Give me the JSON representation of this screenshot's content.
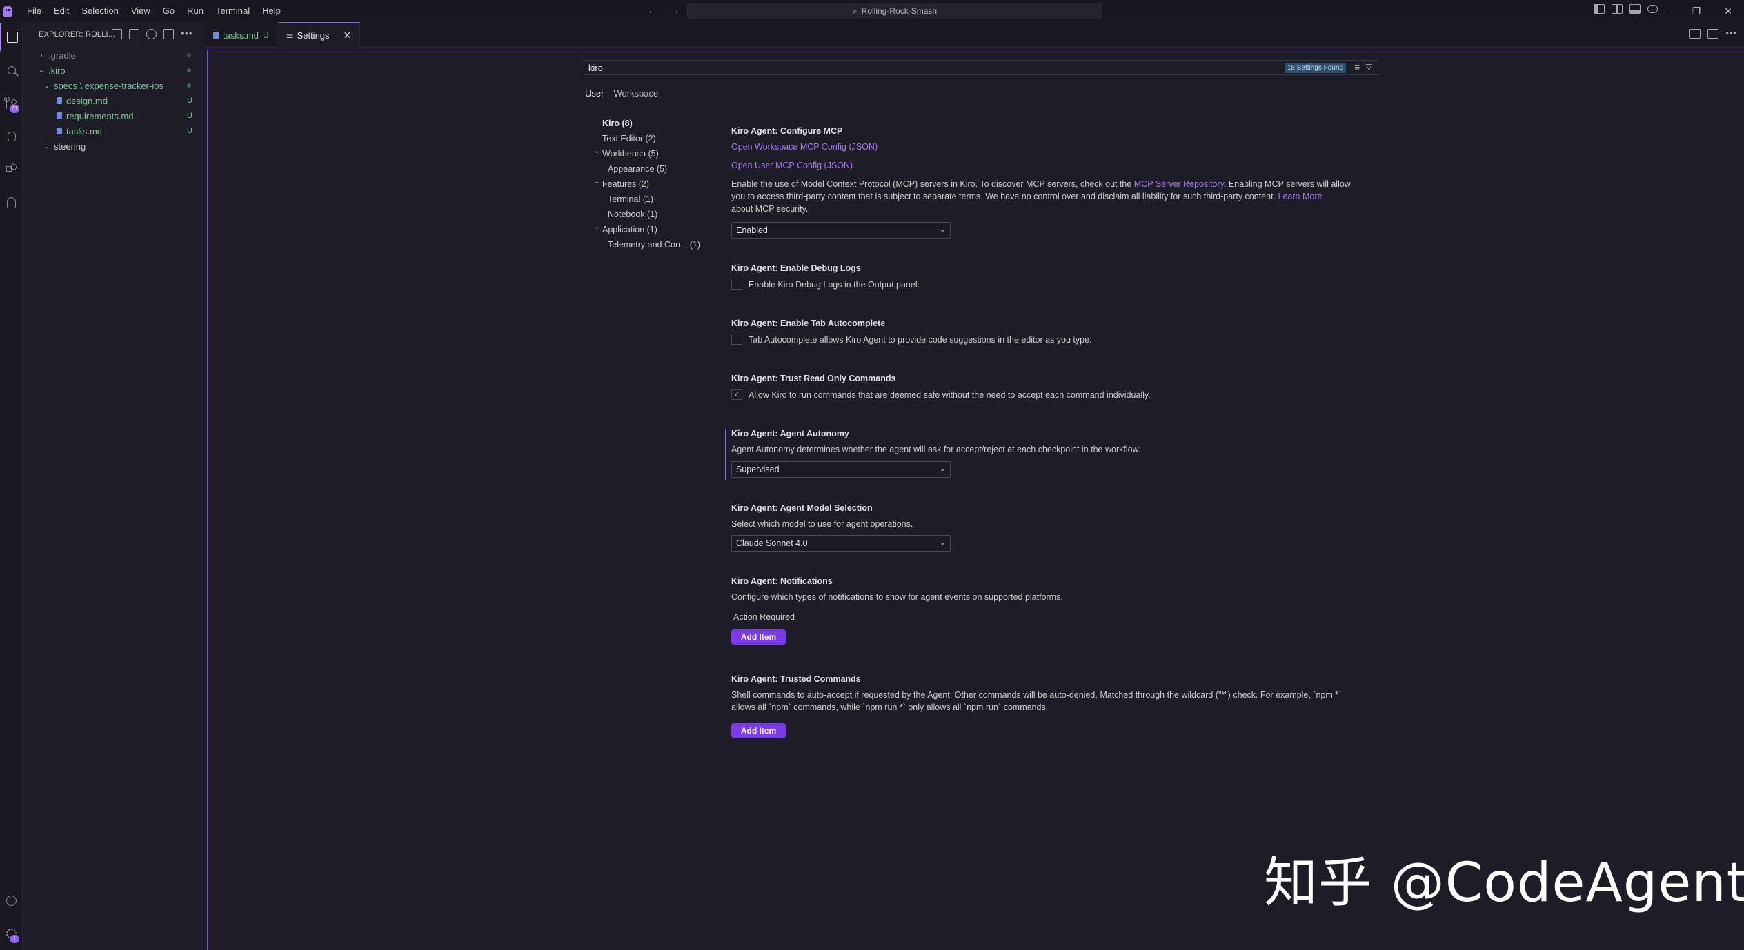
{
  "menubar": [
    "File",
    "Edit",
    "Selection",
    "View",
    "Go",
    "Run",
    "Terminal",
    "Help"
  ],
  "command_center": {
    "label": "Rolling-Rock-Smash"
  },
  "nav": {
    "back": "←",
    "forward": "→"
  },
  "window_controls": {
    "minimize": "—",
    "restore": "❐",
    "close": "✕"
  },
  "activity": {
    "scm_badge": "71",
    "gear_badge": "1"
  },
  "explorer": {
    "title": "EXPLORER: ROLLI...",
    "tree": [
      {
        "label": ".gradle",
        "chevron": "›",
        "status": "",
        "dot": true,
        "color": "#8a8896"
      },
      {
        "label": ".kiro",
        "chevron": "⌄",
        "status": "",
        "dot": true,
        "color": "#73c991"
      },
      {
        "label": "specs \\ expense-tracker-ios",
        "chevron": "⌄",
        "status": "",
        "dot": true,
        "color": "#73c991"
      },
      {
        "label": "design.md",
        "chevron": "",
        "status": "U",
        "dot": false,
        "color": "#73c991"
      },
      {
        "label": "requirements.md",
        "chevron": "",
        "status": "U",
        "dot": false,
        "color": "#73c991"
      },
      {
        "label": "tasks.md",
        "chevron": "",
        "status": "U",
        "dot": false,
        "color": "#73c991"
      },
      {
        "label": "steering",
        "chevron": "⌄",
        "status": "",
        "dot": false,
        "color": "#cccccc"
      }
    ]
  },
  "tabs": [
    {
      "label": "tasks.md",
      "status": "U"
    },
    {
      "label": "Settings",
      "close": "✕"
    }
  ],
  "settings": {
    "search_value": "kiro",
    "found_badge": "18 Settings Found",
    "scopes": [
      "User",
      "Workspace"
    ],
    "toc": [
      {
        "label": "Kiro (8)",
        "bold": true,
        "chevron": ""
      },
      {
        "label": "Text Editor (2)",
        "bold": false,
        "chevron": ""
      },
      {
        "label": "Workbench (5)",
        "bold": false,
        "chevron": "⌄"
      },
      {
        "label": "Appearance (5)",
        "bold": false,
        "chevron": ""
      },
      {
        "label": "Features (2)",
        "bold": false,
        "chevron": "⌄"
      },
      {
        "label": "Terminal (1)",
        "bold": false,
        "chevron": ""
      },
      {
        "label": "Notebook (1)",
        "bold": false,
        "chevron": ""
      },
      {
        "label": "Application (1)",
        "bold": false,
        "chevron": "⌄"
      },
      {
        "label": "Telemetry and Con...  (1)",
        "bold": false,
        "chevron": ""
      }
    ],
    "configure_mcp": {
      "title": "Kiro Agent: Configure MCP",
      "link_workspace": "Open Workspace MCP Config (JSON)",
      "link_user": "Open User MCP Config (JSON)",
      "desc_1a": "Enable the use of Model Context Protocol (MCP) servers in Kiro. To discover MCP servers, check out the ",
      "desc_1_link": "MCP Server Repository",
      "desc_1b": ". Enabling MCP servers will allow",
      "desc_2a": "you to access third-party content that is subject to separate terms. We have no control over and disclaim all liability for such third-party content. ",
      "desc_2_link": "Learn More",
      "desc_3": "about MCP security.",
      "value": "Enabled"
    },
    "debug_logs": {
      "title": "Kiro Agent: Enable Debug Logs",
      "label": "Enable Kiro Debug Logs in the Output panel.",
      "checked": false
    },
    "tab_autocomplete": {
      "title": "Kiro Agent: Enable Tab Autocomplete",
      "label": "Tab Autocomplete allows Kiro Agent to provide code suggestions in the editor as you type.",
      "checked": false
    },
    "trust_read_only": {
      "title": "Kiro Agent: Trust Read Only Commands",
      "label": "Allow Kiro to run commands that are deemed safe without the need to accept each command individually.",
      "checked": true,
      "check_glyph": "✓"
    },
    "agent_autonomy": {
      "title": "Kiro Agent: Agent Autonomy",
      "desc": "Agent Autonomy determines whether the agent will ask for accept/reject at each checkpoint in the workflow.",
      "value": "Supervised"
    },
    "model_selection": {
      "title": "Kiro Agent: Agent Model Selection",
      "desc": "Select which model to use for agent operations.",
      "value": "Claude Sonnet 4.0"
    },
    "notifications": {
      "title": "Kiro Agent: Notifications",
      "desc": "Configure which types of notifications to show for agent events on supported platforms.",
      "items": [
        "Action Required"
      ],
      "add_label": "Add Item"
    },
    "trusted_commands": {
      "title": "Kiro Agent: Trusted Commands",
      "desc_1": "Shell commands to auto-accept if requested by the Agent. Other commands will be auto-denied. Matched through the wildcard (\"*\") check. For example, `npm *`",
      "desc_2": "allows all `npm` commands, while `npm run *` only allows all `npm run` commands.",
      "add_label": "Add Item"
    }
  },
  "watermark": "知乎 @CodeAgent"
}
